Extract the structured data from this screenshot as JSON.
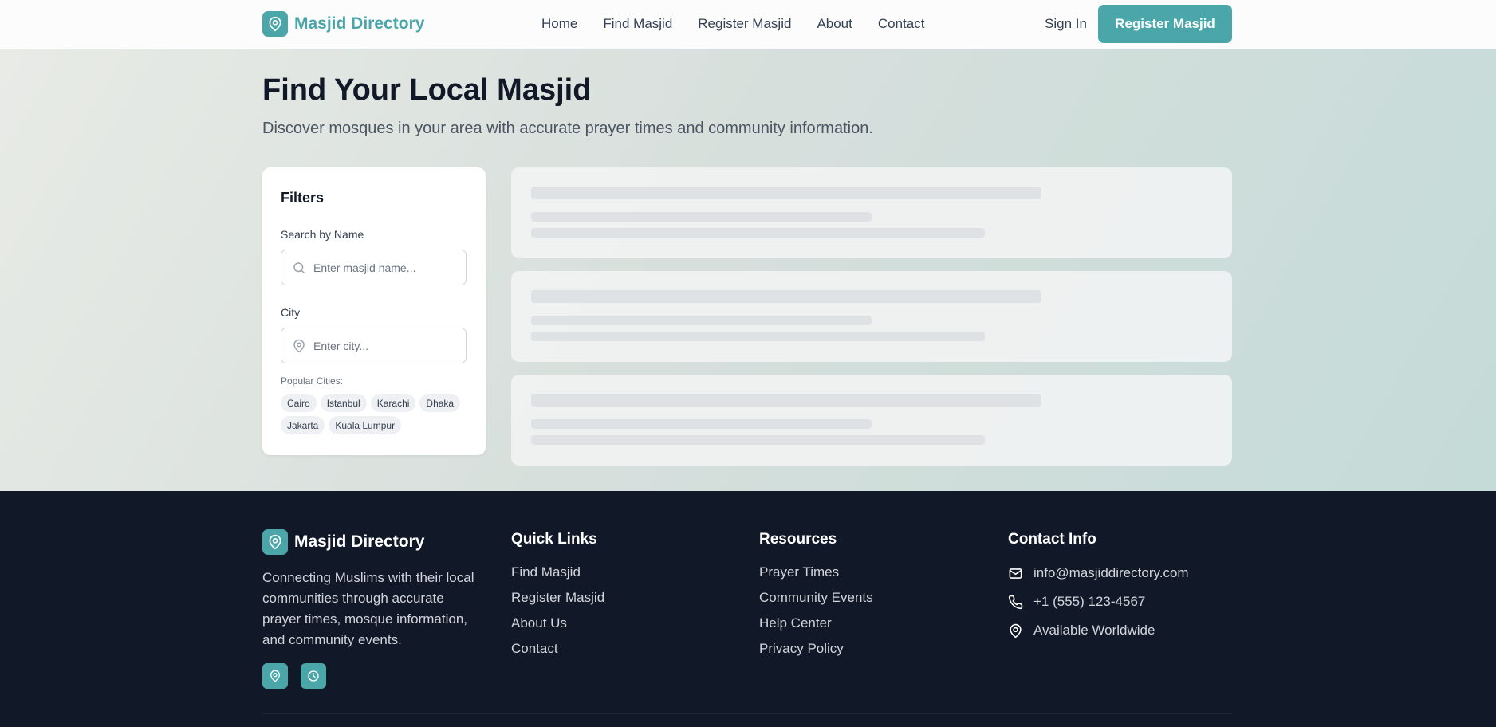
{
  "header": {
    "brand": "Masjid Directory",
    "nav": [
      "Home",
      "Find Masjid",
      "Register Masjid",
      "About",
      "Contact"
    ],
    "sign_in": "Sign In",
    "cta": "Register Masjid"
  },
  "hero": {
    "title": "Find Your Local Masjid",
    "subtitle": "Discover mosques in your area with accurate prayer times and community information."
  },
  "filters": {
    "title": "Filters",
    "search_label": "Search by Name",
    "search_placeholder": "Enter masjid name...",
    "city_label": "City",
    "city_placeholder": "Enter city...",
    "popular_label": "Popular Cities:",
    "popular_cities": [
      "Cairo",
      "Istanbul",
      "Karachi",
      "Dhaka",
      "Jakarta",
      "Kuala Lumpur"
    ]
  },
  "footer": {
    "brand": "Masjid Directory",
    "description": "Connecting Muslims with their local communities through accurate prayer times, mosque information, and community events.",
    "quick_links_title": "Quick Links",
    "quick_links": [
      "Find Masjid",
      "Register Masjid",
      "About Us",
      "Contact"
    ],
    "resources_title": "Resources",
    "resources": [
      "Prayer Times",
      "Community Events",
      "Help Center",
      "Privacy Policy"
    ],
    "contact_title": "Contact Info",
    "email": "info@masjiddirectory.com",
    "phone": "+1 (555) 123-4567",
    "location": "Available Worldwide"
  },
  "colors": {
    "accent": "#4ba6aa",
    "footer_bg": "#111827"
  },
  "icons": {
    "logo": "map-pin-icon",
    "search": "search-icon",
    "city": "map-pin-icon",
    "social": [
      "map-pin-icon",
      "clock-icon"
    ],
    "contact": [
      "mail-icon",
      "phone-icon",
      "map-pin-icon"
    ]
  }
}
